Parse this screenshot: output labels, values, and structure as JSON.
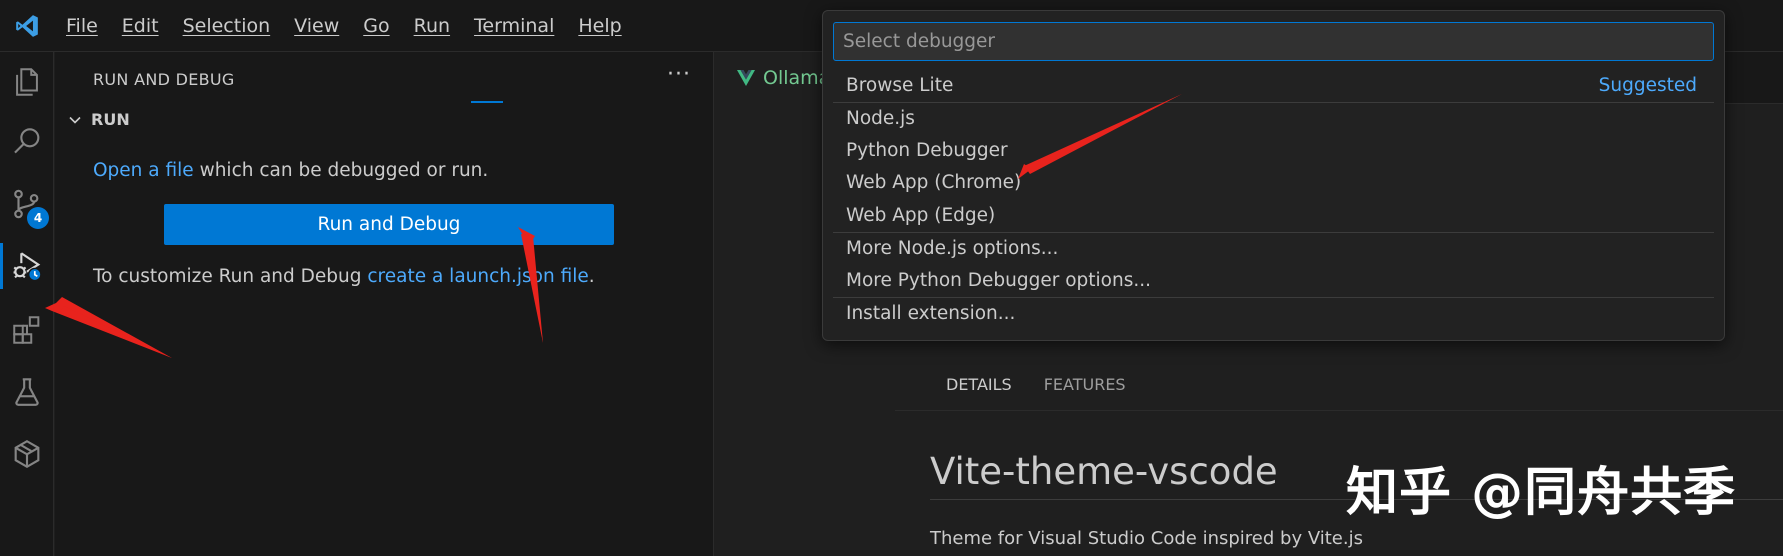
{
  "menu": [
    "File",
    "Edit",
    "Selection",
    "View",
    "Go",
    "Run",
    "Terminal",
    "Help"
  ],
  "activity": {
    "source_control_badge": "4"
  },
  "sidebar": {
    "title": "RUN AND DEBUG",
    "more": "···",
    "section": "RUN",
    "open_file_link": "Open a file",
    "open_file_rest": " which can be debugged or run.",
    "run_button": "Run and Debug",
    "customize_prefix": "To customize Run and Debug ",
    "customize_link": "create a launch.json file",
    "customize_suffix": "."
  },
  "editor": {
    "tab_label": "Ollama",
    "ext_tabs": [
      "DETAILS",
      "FEATURES"
    ],
    "ext_title": "Vite-theme-vscode",
    "ext_desc": "Theme for Visual Studio Code inspired by Vite.js"
  },
  "quickpick": {
    "placeholder": "Select debugger",
    "items": [
      {
        "label": "Browse Lite",
        "hint": "Suggested"
      },
      {
        "label": "Node.js"
      },
      {
        "label": "Python Debugger"
      },
      {
        "label": "Web App (Chrome)"
      },
      {
        "label": "Web App (Edge)"
      },
      {
        "label": "More Node.js options..."
      },
      {
        "label": "More Python Debugger options..."
      },
      {
        "label": "Install extension..."
      }
    ]
  },
  "watermark": "知乎 @同舟共季",
  "colors": {
    "accent": "#0078d4",
    "link": "#4daafc",
    "arrow": "#e8231d"
  }
}
